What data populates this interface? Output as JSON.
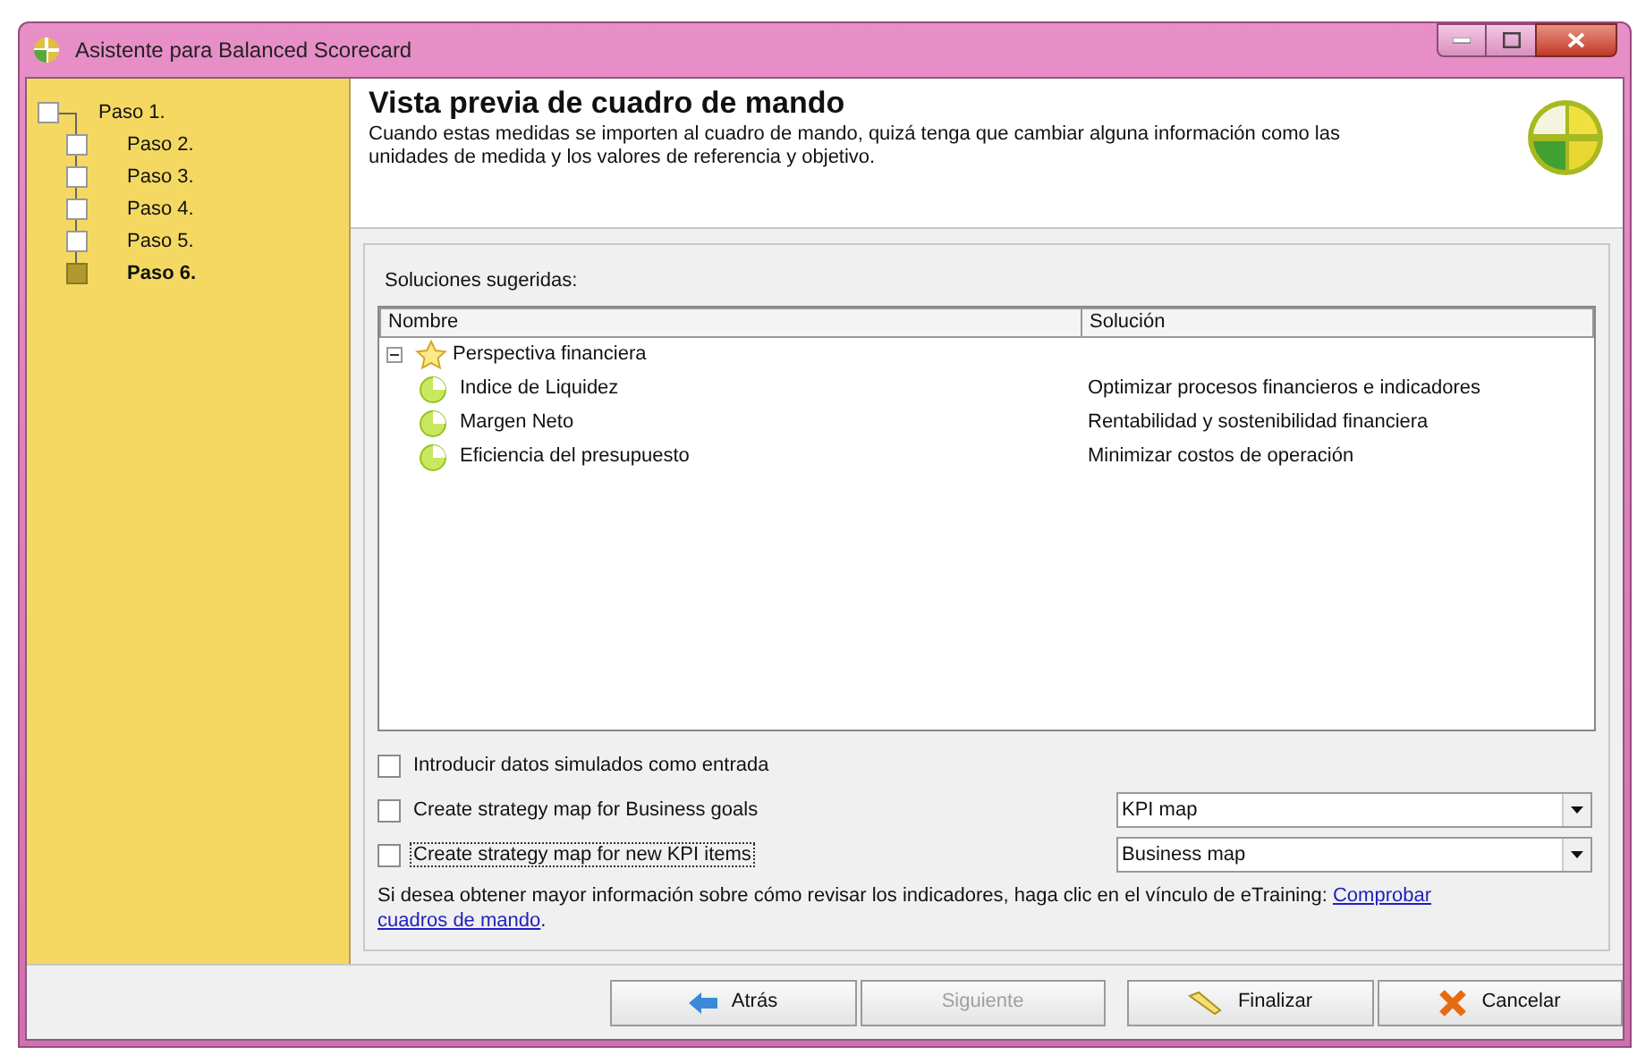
{
  "window": {
    "title": "Asistente para Balanced Scorecard"
  },
  "steps": [
    {
      "label": "Paso 1.",
      "selected": false
    },
    {
      "label": "Paso 2.",
      "selected": false
    },
    {
      "label": "Paso 3.",
      "selected": false
    },
    {
      "label": "Paso 4.",
      "selected": false
    },
    {
      "label": "Paso 5.",
      "selected": false
    },
    {
      "label": "Paso 6.",
      "selected": true
    }
  ],
  "header": {
    "title": "Vista previa de cuadro de mando",
    "description": "Cuando estas medidas se importen al cuadro de mando, quizá tenga que cambiar alguna información como las unidades de medida y los valores de referencia y objetivo."
  },
  "group_label": "Soluciones sugeridas:",
  "tree": {
    "columns": [
      "Nombre",
      "Solución"
    ],
    "rows": [
      {
        "name": "Perspectiva financiera",
        "expanded": true,
        "children": [
          {
            "name": "Indice de Liquidez",
            "solution": "Optimizar procesos financieros e indicadores"
          },
          {
            "name": "Margen Neto",
            "solution": "Rentabilidad y sostenibilidad financiera"
          },
          {
            "name": "Eficiencia del presupuesto",
            "solution": "Minimizar costos de operación"
          }
        ]
      }
    ]
  },
  "options": [
    {
      "label": "Introducir datos simulados como entrada",
      "checked": false,
      "focused": false
    },
    {
      "label": "Create strategy map for Business goals",
      "checked": false,
      "focused": false,
      "select": "KPI map"
    },
    {
      "label": "Create strategy map for new KPI items",
      "checked": false,
      "focused": true,
      "select": "Business map"
    }
  ],
  "info": {
    "text": "Si desea obtener mayor información sobre cómo revisar los indicadores, haga clic en el vínculo de eTraining:",
    "link_start": "Comprobar",
    "link_end": "cuadros de mando",
    "end": "."
  },
  "buttons": [
    {
      "label": "Atrás",
      "kind": "back",
      "disabled": false
    },
    {
      "label": "Siguiente",
      "kind": "next",
      "disabled": true
    },
    {
      "label": "Finalizar",
      "kind": "finish",
      "disabled": false
    },
    {
      "label": "Cancelar",
      "kind": "cancel",
      "disabled": false
    }
  ]
}
